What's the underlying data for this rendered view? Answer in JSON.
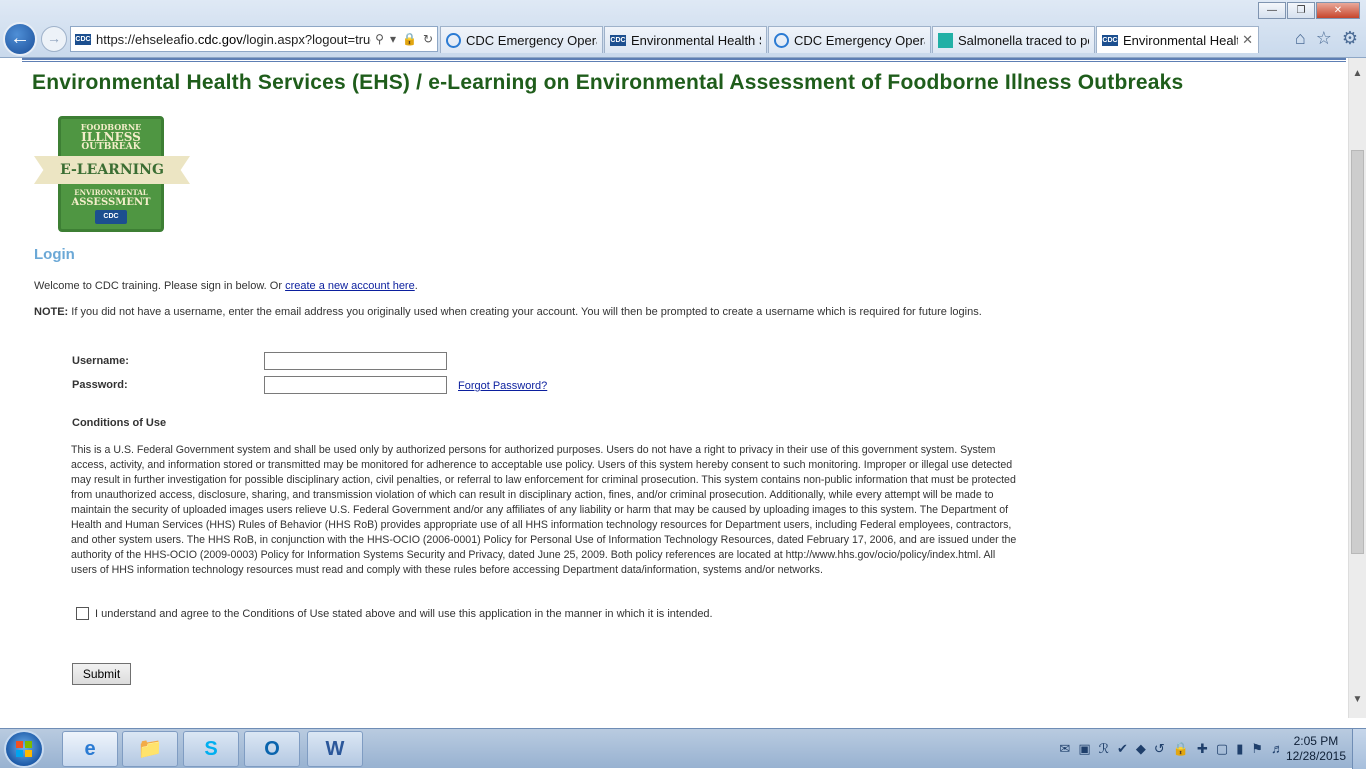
{
  "browser": {
    "url_prefix": "https://ehseleafio.",
    "url_domain": "cdc.gov",
    "url_suffix": "/login.aspx?logout=true",
    "tabs": [
      {
        "label": "CDC Emergency Opera...",
        "favicon": "ie-icon"
      },
      {
        "label": "Environmental Health S...",
        "favicon": "cdc-icon"
      },
      {
        "label": "CDC Emergency Opera...",
        "favicon": "ie-icon"
      },
      {
        "label": "Salmonella traced to pe...",
        "favicon": "news-icon"
      },
      {
        "label": "Environmental Health...",
        "favicon": "cdc-icon",
        "active": true
      }
    ],
    "favicon_text": "CDC"
  },
  "page": {
    "title": "Environmental Health Services (EHS) / e-Learning on Environmental Assessment of Foodborne Illness Outbreaks",
    "logo": {
      "line1": "FOODBORNE",
      "line2": "ILLNESS",
      "line3": "OUTBREAK",
      "ribbon": "E-LEARNING",
      "line4": "ENVIRONMENTAL",
      "line5": "ASSESSMENT",
      "mark": "CDC"
    },
    "login_heading": "Login",
    "welcome_text": "Welcome to CDC training. Please sign in below. Or ",
    "create_account_link": "create a new account here",
    "welcome_end": ".",
    "note_label": "NOTE:",
    "note_text": " If you did not have a username, enter the email address you originally used when creating your account. You will then be prompted to create a username which is required for future logins.",
    "username_label": "Username:",
    "username_value": "",
    "password_label": "Password:",
    "password_value": "",
    "forgot_link": "Forgot Password?",
    "conditions_heading": "Conditions of Use",
    "conditions_text": "This is a U.S. Federal Government system and shall be used only by authorized persons for authorized purposes. Users do not have a right to privacy in their use of this government system. System access, activity, and information stored or transmitted may be monitored for adherence to acceptable use policy. Users of this system hereby consent to such monitoring. Improper or illegal use detected may result in further investigation for possible disciplinary action, civil penalties, or referral to law enforcement for criminal prosecution. This system contains non-public information that must be protected from unauthorized access, disclosure, sharing, and transmission violation of which can result in disciplinary action, fines, and/or criminal prosecution. Additionally, while every attempt will be made to maintain the security of uploaded images users relieve U.S. Federal Government and/or any affiliates of any liability or harm that may be caused by uploading images to this system. The Department of Health and Human Services (HHS) Rules of Behavior (HHS RoB) provides appropriate use of all HHS information technology resources for Department users, including Federal employees, contractors, and other system users. The HHS RoB, in conjunction with the HHS-OCIO (2006-0001) Policy for Personal Use of Information Technology Resources, dated February 17, 2006, and are issued under the authority of the HHS-OCIO (2009-0003) Policy for Information Systems Security and Privacy, dated June 25, 2009. Both policy references are located at http://www.hhs.gov/ocio/policy/index.html. All users of HHS information technology resources must read and comply with these rules before accessing Department data/information, systems and/or networks.",
    "agree_text": "I understand and agree to the Conditions of Use stated above and will use this application in the manner in which it is intended.",
    "agree_checked": false,
    "submit_label": "Submit"
  },
  "taskbar": {
    "time": "2:05 PM",
    "date": "12/28/2015"
  },
  "colors": {
    "title_green": "#1f5d1b",
    "login_blue": "#6ba8d6",
    "link_blue": "#0b1f9e",
    "logo_green": "#4f9642"
  }
}
